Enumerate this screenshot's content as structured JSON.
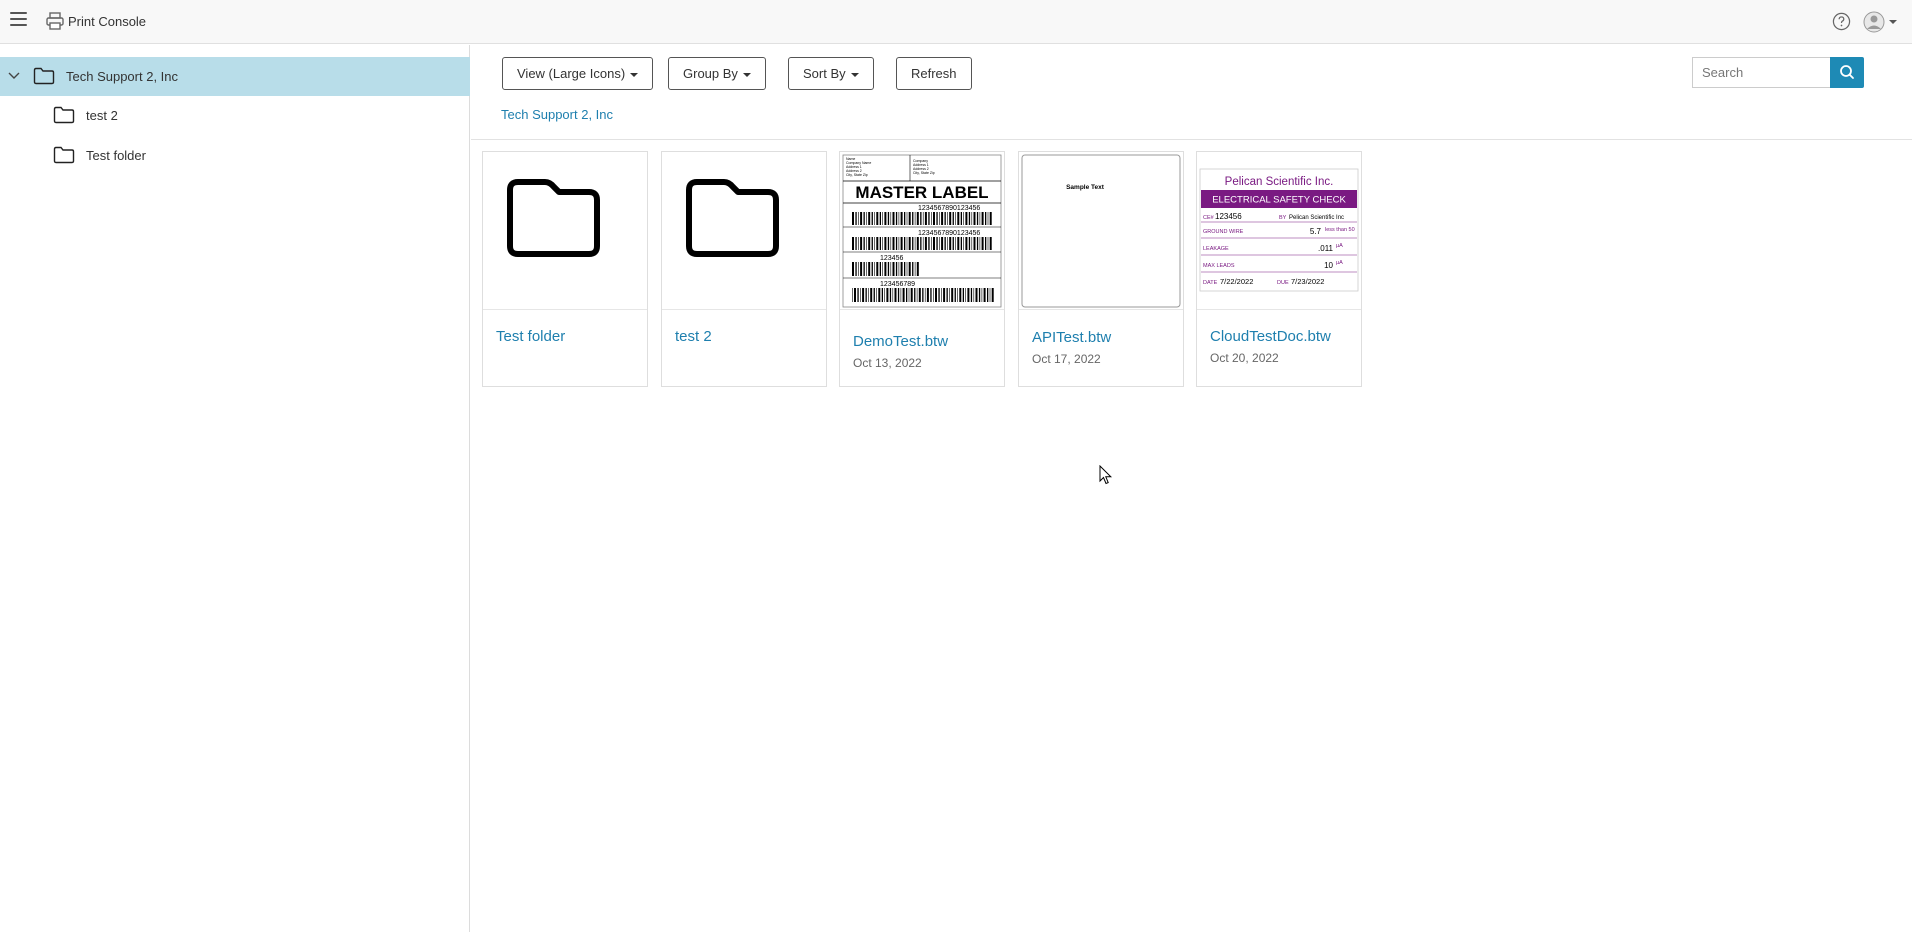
{
  "header": {
    "app_title": "Print Console",
    "menu_icon": "hamburger-menu-icon",
    "app_icon": "printer-icon",
    "help_icon": "help-circle-icon",
    "user_icon": "user-avatar-icon"
  },
  "sidebar": {
    "items": [
      {
        "label": "Tech Support 2, Inc",
        "icon": "folder-icon",
        "expanded": true,
        "selected": true
      },
      {
        "label": "test 2",
        "icon": "folder-icon"
      },
      {
        "label": "Test folder",
        "icon": "folder-icon"
      }
    ]
  },
  "toolbar": {
    "view_label": "View (Large Icons)",
    "group_label": "Group By",
    "sort_label": "Sort By",
    "refresh_label": "Refresh",
    "search_placeholder": "Search"
  },
  "breadcrumb": "Tech Support 2, Inc",
  "accent_color": "#1e8ab5",
  "selected_color": "#b8dde9",
  "cards": [
    {
      "name": "Test folder",
      "type": "folder"
    },
    {
      "name": "test 2",
      "type": "folder"
    },
    {
      "name": "DemoTest.btw",
      "date": "Oct 13, 2022",
      "type": "document"
    },
    {
      "name": "APITest.btw",
      "date": "Oct 17, 2022",
      "type": "document"
    },
    {
      "name": "CloudTestDoc.btw",
      "date": "Oct 20, 2022",
      "type": "document"
    }
  ],
  "thumbnails": {
    "demo": {
      "from": [
        "Name",
        "Company Name",
        "Address 1",
        "Address 2",
        "City, State Zip"
      ],
      "to": [
        "Company",
        "Address 1",
        "Address 2",
        "City, State Zip"
      ],
      "title": "MASTER LABEL",
      "codes": [
        "1234567890123456",
        "1234567890123456",
        "123456",
        "123456789"
      ]
    },
    "api": {
      "sample": "Sample Text"
    },
    "cloud": {
      "company": "Pelican Scientific Inc.",
      "banner": "ELECTRICAL SAFETY CHECK",
      "cert_label": "CE#",
      "cert_value": "123456",
      "by_label": "BY",
      "by_value": "Pelican Scientific Inc",
      "ground_label": "GROUND WIRE",
      "ground_value": "5.7",
      "ground_note": "less than 50",
      "leakage_label": "LEAKAGE",
      "leakage_value": ".011",
      "leakage_unit": "µA",
      "leads_label": "MAX LEADS",
      "leads_value": "10",
      "leads_unit": "µA",
      "date_label": "DATE",
      "date_value": "7/22/2022",
      "due_label": "DUE",
      "due_value": "7/23/2022"
    }
  }
}
